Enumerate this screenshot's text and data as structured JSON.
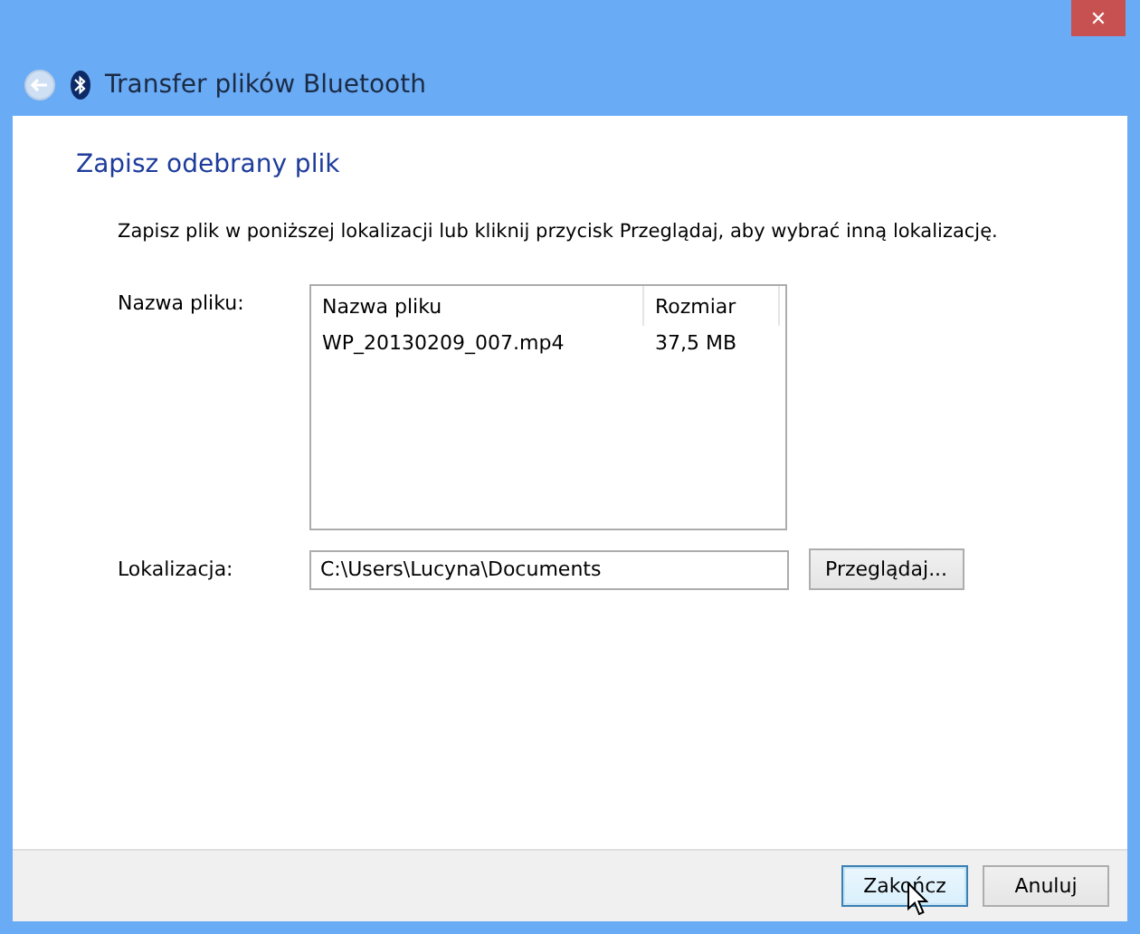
{
  "window": {
    "title": "Transfer plików Bluetooth",
    "close": "✕"
  },
  "heading": "Zapisz odebrany plik",
  "instruction": "Zapisz plik w poniższej lokalizacji lub kliknij przycisk Przeglądaj, aby wybrać inną lokalizację.",
  "file_label": "Nazwa pliku:",
  "file_list": {
    "columns": [
      "Nazwa pliku",
      "Rozmiar"
    ],
    "rows": [
      [
        "WP_20130209_007.mp4",
        "37,5 MB"
      ]
    ]
  },
  "location_label": "Lokalizacja:",
  "location_value": "C:\\Users\\Lucyna\\Documents",
  "browse_button": "Przeglądaj...",
  "buttons": [
    {
      "label": "Zakończ",
      "default": true
    },
    {
      "label": "Anuluj",
      "default": false
    }
  ]
}
